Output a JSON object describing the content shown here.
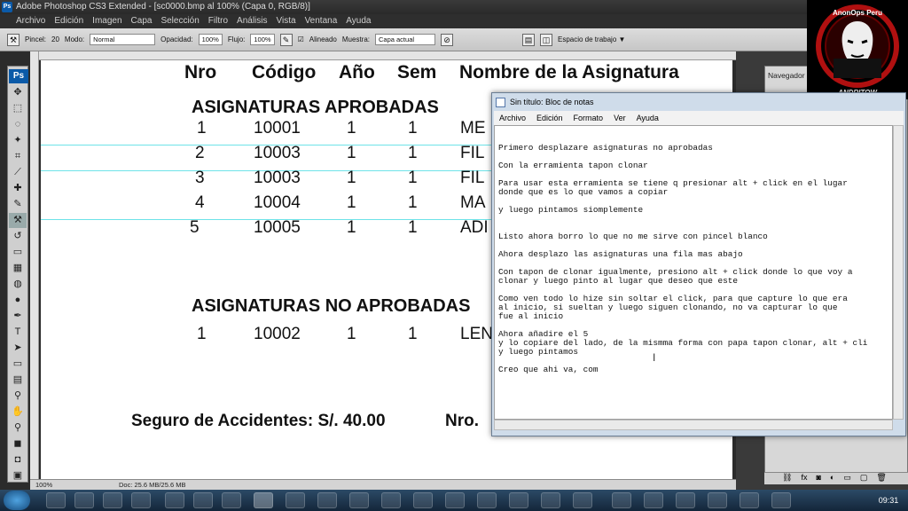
{
  "ps": {
    "title": "Adobe Photoshop CS3 Extended - [sc0000.bmp al 100% (Capa 0, RGB/8)]",
    "menu": [
      "Archivo",
      "Edición",
      "Imagen",
      "Capa",
      "Selección",
      "Filtro",
      "Análisis",
      "Vista",
      "Ventana",
      "Ayuda"
    ],
    "options": {
      "brush_label": "Pincel:",
      "brush_size": "20",
      "mode_label": "Modo:",
      "mode_value": "Normal",
      "opacity_label": "Opacidad:",
      "opacity_value": "100%",
      "flow_label": "Flujo:",
      "flow_value": "100%",
      "aligned_label": "Alineado",
      "sample_label": "Muestra:",
      "sample_value": "Capa actual",
      "workspace": "Espacio de trabajo ▼"
    },
    "badge": "Ps",
    "status_zoom": "100%",
    "status_doc": "Doc: 25.6 MB/25.6 MB",
    "navigator_tab": "Navegador"
  },
  "doc": {
    "headers": [
      "Nro",
      "Código",
      "Año",
      "Sem",
      "Nombre de la Asignatura"
    ],
    "approved_title": "ASIGNATURAS APROBADAS",
    "approved_rows": [
      {
        "nro": "1",
        "code": "10001",
        "year": "1",
        "sem": "1",
        "name": "ME"
      },
      {
        "nro": "2",
        "code": "10003",
        "year": "1",
        "sem": "1",
        "name": "FIL"
      },
      {
        "nro": "3",
        "code": "10003",
        "year": "1",
        "sem": "1",
        "name": "FIL"
      },
      {
        "nro": "4",
        "code": "10004",
        "year": "1",
        "sem": "1",
        "name": "MA"
      },
      {
        "nro": "5",
        "code": "10005",
        "year": "1",
        "sem": "1",
        "name": "ADI"
      }
    ],
    "not_approved_title": "ASIGNATURAS NO APROBADAS",
    "not_approved_rows": [
      {
        "nro": "1",
        "code": "10002",
        "year": "1",
        "sem": "1",
        "name": "LEN"
      }
    ],
    "footer": "Seguro de Accidentes: S/. 40.00",
    "footer_nro": "Nro."
  },
  "notepad": {
    "title": "Sin título: Bloc de notas",
    "menu": [
      "Archivo",
      "Edición",
      "Formato",
      "Ver",
      "Ayuda"
    ],
    "lines": [
      "Primero desplazare asignaturas no aprobadas",
      "",
      "Con la erramienta tapon clonar",
      "",
      "Para usar esta erramienta se tiene q presionar alt + click en el lugar",
      "donde que es lo que vamos a copiar",
      "",
      "y luego pintamos siomplemente",
      "",
      "",
      "Listo ahora borro lo que no me sirve con pincel blanco",
      "",
      "Ahora desplazo las asignaturas una fila mas abajo",
      "",
      "Con tapon de clonar igualmente, presiono alt + click donde lo que voy a",
      "clonar y luego pinto al lugar que deseo que este",
      "",
      "Como ven todo lo hize sin soltar el click, para que capture lo que era",
      "al inicio, si sueltan y luego siguen clonando, no va capturar lo que",
      "fue al inicio",
      "",
      "Ahora añadire el 5",
      "y lo copiare del lado, de la mismma forma con papa tapon clonar, alt + cli",
      "y luego pintamos",
      "",
      "Creo que ahi va, com"
    ]
  },
  "logo": {
    "top_text": "AnonOps Peru",
    "bottom_text": "ANDRITOW"
  },
  "clock": "09:31"
}
